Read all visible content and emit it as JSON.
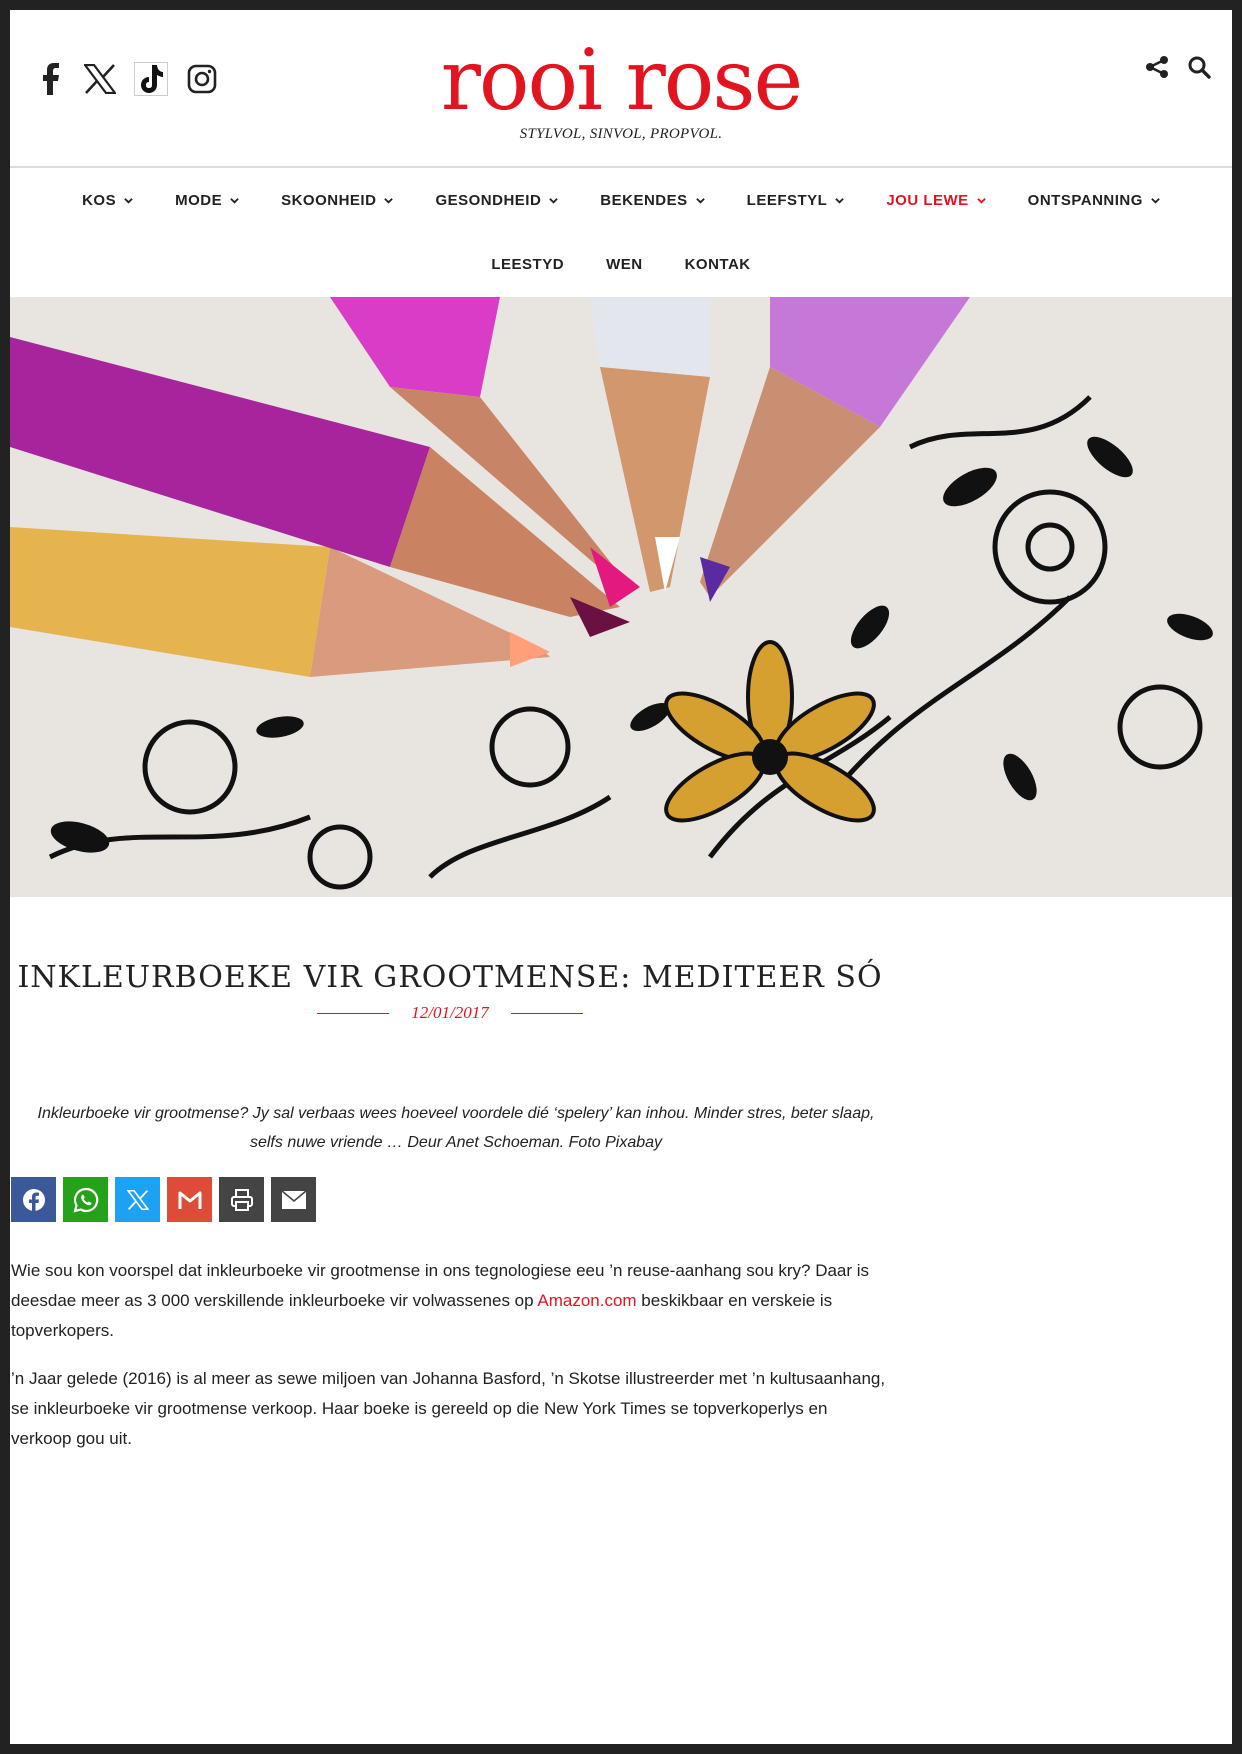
{
  "brand": {
    "logo": "rooi rose",
    "tagline": "STYLVOL, SINVOL, PROPVOL.",
    "accent_color": "#e2141f"
  },
  "social_icons": [
    "facebook-icon",
    "x-icon",
    "tiktok-icon",
    "instagram-icon"
  ],
  "tool_icons": [
    "share-icon",
    "search-icon"
  ],
  "nav": {
    "row1": [
      {
        "label": "KOS",
        "active": false
      },
      {
        "label": "MODE",
        "active": false
      },
      {
        "label": "SKOONHEID",
        "active": false
      },
      {
        "label": "GESONDHEID",
        "active": false
      },
      {
        "label": "BEKENDES",
        "active": false
      },
      {
        "label": "LEEFSTYL",
        "active": false
      },
      {
        "label": "JOU LEWE",
        "active": true
      },
      {
        "label": "ONTSPANNING",
        "active": false
      }
    ],
    "row2": [
      {
        "label": "LEESTYD"
      },
      {
        "label": "WEN"
      },
      {
        "label": "KONTAK"
      }
    ]
  },
  "article": {
    "title": "INKLEURBOEKE VIR GROOTMENSE: MEDITEER SÓ",
    "date": "12/01/2017",
    "intro_line1": "Inkleurboeke vir grootmense? Jy sal verbaas wees hoeveel voordele dié ‘spelery’ kan inhou. Minder stres, beter slaap,",
    "intro_line2": "selfs nuwe vriende … Deur Anet Schoeman. Foto Pixabay",
    "p1_before": "Wie sou kon voorspel dat inkleurboeke vir grootmense in ons tegnologiese eeu ’n reuse-aanhang sou kry? Daar is deesdae meer as 3 000 verskillende inkleurboeke vir volwassenes op ",
    "p1_link": "Amazon.com",
    "p1_after": " beskikbaar en verskeie is topverkopers.",
    "p2": "’n Jaar gelede (2016) is al meer as sewe miljoen van Johanna Basford, ’n Skotse illustreerder met ’n kultusaanhang, se inkleurboeke vir grootmense verkoop. Haar boeke is gereeld op die New York Times se topverkoperlys en verkoop gou uit."
  },
  "share_buttons": [
    {
      "name": "facebook",
      "color": "#3b5998"
    },
    {
      "name": "whatsapp",
      "color": "#25a21a"
    },
    {
      "name": "x",
      "color": "#1da1f2"
    },
    {
      "name": "gmail",
      "color": "#dd4b39"
    },
    {
      "name": "print",
      "color": "#444444"
    },
    {
      "name": "email",
      "color": "#444444"
    }
  ]
}
